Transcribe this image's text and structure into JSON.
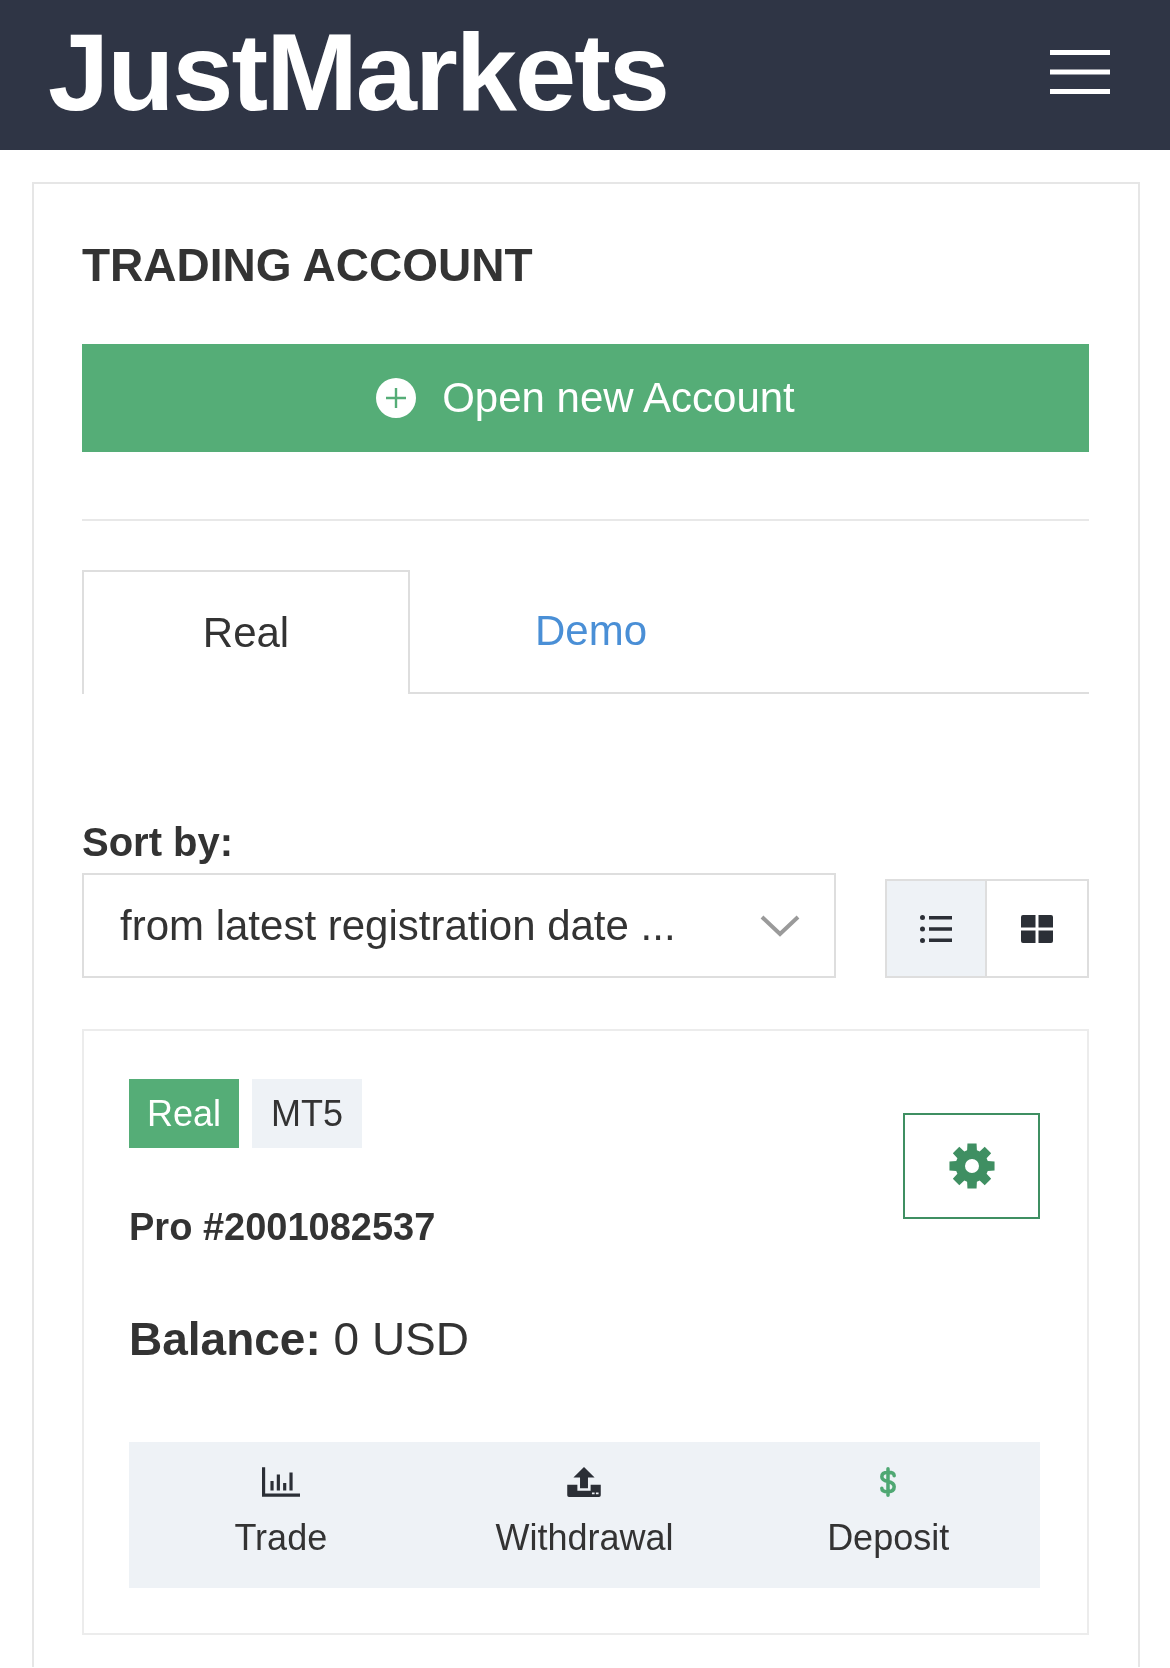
{
  "header": {
    "logo": "JustMarkets"
  },
  "panel": {
    "title": "TRADING ACCOUNT",
    "open_account_button": "Open new Account"
  },
  "tabs": [
    {
      "label": "Real",
      "selected": true
    },
    {
      "label": "Demo",
      "selected": false
    }
  ],
  "sort": {
    "label": "Sort by:",
    "value": "from latest registration date ..."
  },
  "view_modes": [
    {
      "kind": "list",
      "selected": true
    },
    {
      "kind": "grid",
      "selected": false
    }
  ],
  "accounts": [
    {
      "tags": [
        {
          "kind": "type",
          "label": "Real"
        },
        {
          "kind": "platform",
          "label": "MT5"
        }
      ],
      "number": "Pro #2001082537",
      "balance": "**Balance:** 0 USD",
      "actions": [
        {
          "kind": "trade",
          "label": "Trade"
        },
        {
          "kind": "withdrawal",
          "label": "Withdrawal"
        },
        {
          "kind": "deposit",
          "label": "Deposit"
        }
      ]
    }
  ]
}
